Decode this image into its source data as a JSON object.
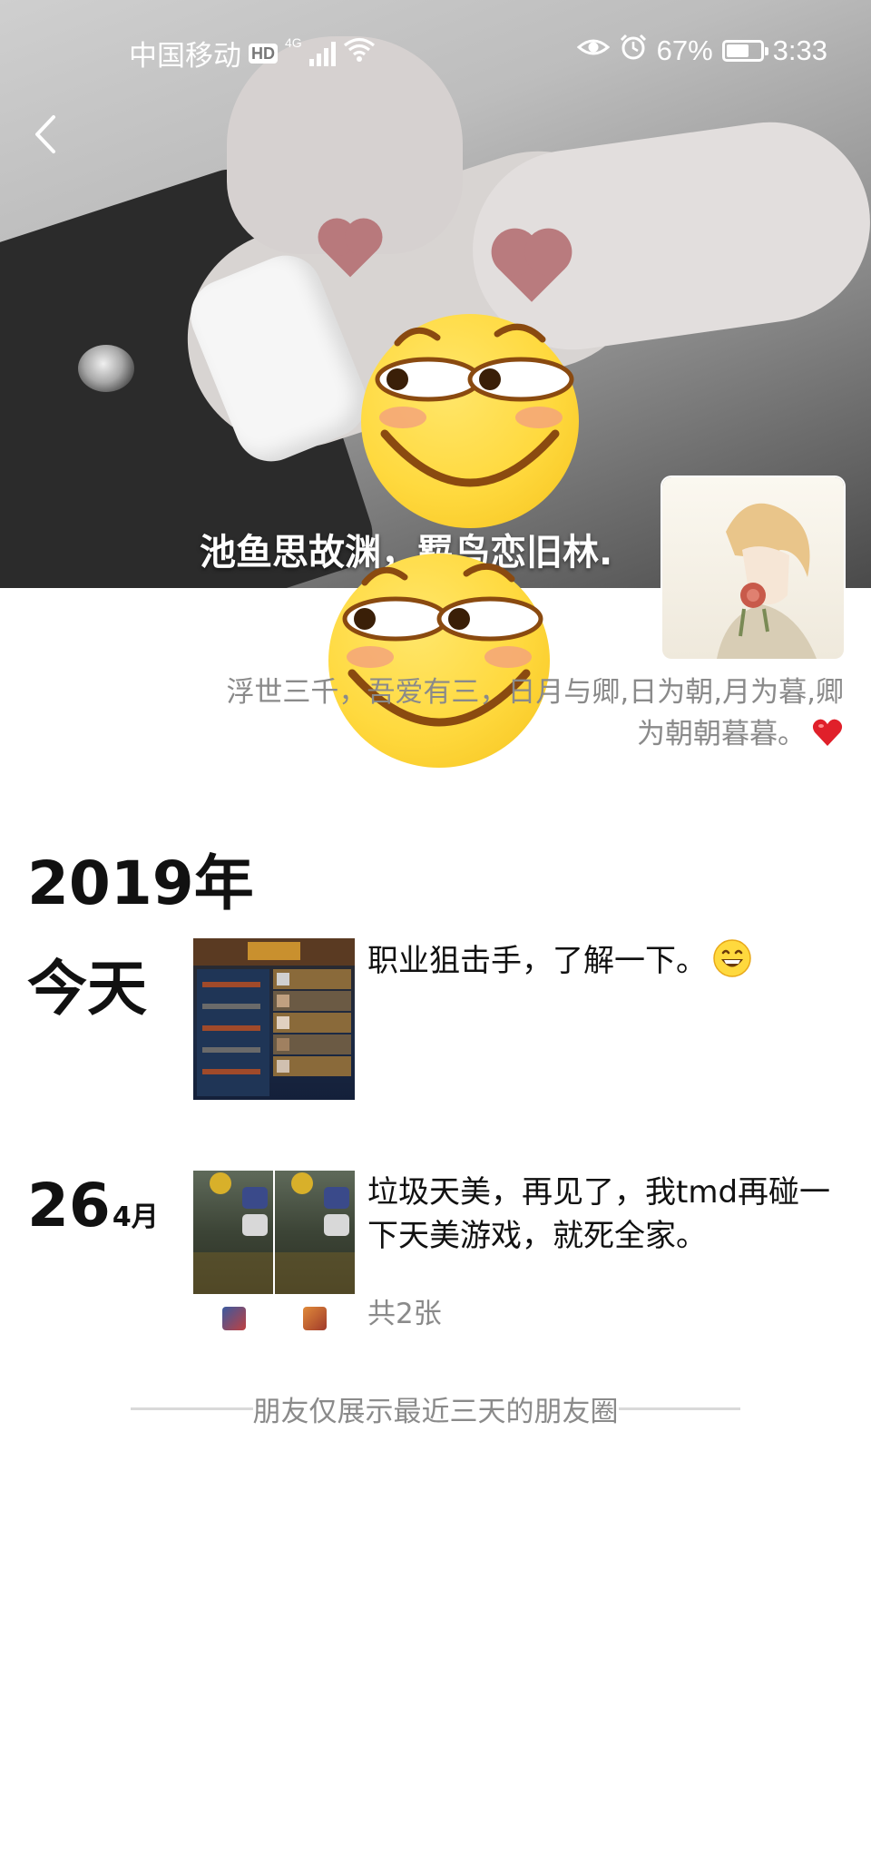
{
  "status_bar": {
    "carrier": "中国移动",
    "hd_badge": "HD",
    "network_type": "4G",
    "battery_percent": "67%",
    "battery_level": 0.67,
    "time": "3:33",
    "icons": [
      "eye-icon",
      "alarm-icon",
      "signal-icon",
      "wifi-icon",
      "battery-icon"
    ]
  },
  "header": {
    "back_icon": "chevron-left-icon"
  },
  "profile": {
    "name": "池鱼思故渊，羁鸟恋旧林.",
    "signature": "浮世三千，吾爱有三，日月与卿,日为朝,月为暮,卿为朝朝暮暮。",
    "signature_emoji": "heart-icon"
  },
  "feed": {
    "year": "2019年",
    "posts": [
      {
        "date_label": "今天",
        "text": "职业狙击手，了解一下。",
        "emoji": "grinning-icon",
        "photo_count": ""
      },
      {
        "date_day": "26",
        "date_month": "4月",
        "text": "垃圾天美，再见了，我tmd再碰一下天美游戏，就死全家。",
        "photo_count": "共2张"
      }
    ],
    "footer_note": "朋友仅展示最近三天的朋友圈"
  },
  "colors": {
    "accent_text": "#111111",
    "muted_text": "#8a8a8a",
    "emoji_yellow": "#ffd93e",
    "heart_red": "#e0202a"
  }
}
